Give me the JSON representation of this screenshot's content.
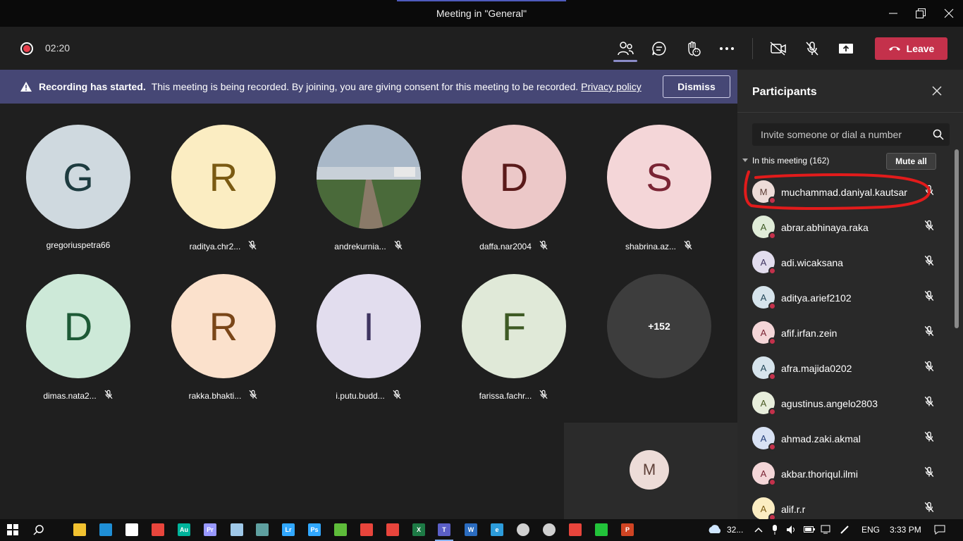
{
  "window": {
    "title": "Meeting in \"General\""
  },
  "meeting": {
    "timer": "02:20",
    "leave_label": "Leave"
  },
  "banner": {
    "bold": "Recording has started.",
    "text": "This meeting is being recorded. By joining, you are giving consent for this meeting to be recorded.",
    "link": "Privacy policy",
    "dismiss": "Dismiss"
  },
  "tiles": [
    {
      "initial": "G",
      "name": "gregoriuspetra66",
      "muted": false,
      "bg": "#cfd9df",
      "fg": "#1d3b3f"
    },
    {
      "initial": "R",
      "name": "raditya.chr2...",
      "muted": true,
      "bg": "#fbedc2",
      "fg": "#7a5a12"
    },
    {
      "initial": "",
      "name": "andrekurnia...",
      "muted": true,
      "bg": "#7a8a7a",
      "fg": "#ffffff"
    },
    {
      "initial": "D",
      "name": "daffa.nar2004",
      "muted": true,
      "bg": "#ecc8c8",
      "fg": "#5a1a1a"
    },
    {
      "initial": "S",
      "name": "shabrina.az...",
      "muted": true,
      "bg": "#f4d6d8",
      "fg": "#7a2434"
    },
    {
      "initial": "D",
      "name": "dimas.nata2...",
      "muted": true,
      "bg": "#cde9d8",
      "fg": "#1d5a36"
    },
    {
      "initial": "R",
      "name": "rakka.bhakti...",
      "muted": true,
      "bg": "#fbe1cc",
      "fg": "#7a4618"
    },
    {
      "initial": "I",
      "name": "i.putu.budd...",
      "muted": true,
      "bg": "#e2ddee",
      "fg": "#3e3460"
    },
    {
      "initial": "F",
      "name": "farissa.fachr...",
      "muted": true,
      "bg": "#e0e9d8",
      "fg": "#3e5a24"
    },
    {
      "initial": "+152",
      "name": "",
      "muted": false,
      "bg": "#3d3d3d",
      "fg": "#ffffff"
    }
  ],
  "selfview": {
    "initial": "M"
  },
  "participants": {
    "title": "Participants",
    "invite_placeholder": "Invite someone or dial a number",
    "section": "In this meeting (162)",
    "mute_all": "Mute all",
    "list": [
      {
        "initial": "M",
        "name": "muchammad.daniyal.kautsar",
        "bg": "#eddcd8",
        "fg": "#5e4038"
      },
      {
        "initial": "A",
        "name": "abrar.abhinaya.raka",
        "bg": "#e0ecd8",
        "fg": "#3e5a24"
      },
      {
        "initial": "A",
        "name": "adi.wicaksana",
        "bg": "#e2ddee",
        "fg": "#3e3460"
      },
      {
        "initial": "A",
        "name": "aditya.arief2102",
        "bg": "#d6e4ec",
        "fg": "#24485a"
      },
      {
        "initial": "A",
        "name": "afif.irfan.zein",
        "bg": "#f4d6d8",
        "fg": "#7a2434"
      },
      {
        "initial": "A",
        "name": "afra.majida0202",
        "bg": "#d6e4ec",
        "fg": "#24485a"
      },
      {
        "initial": "A",
        "name": "agustinus.angelo2803",
        "bg": "#e8eedc",
        "fg": "#4a5a24"
      },
      {
        "initial": "A",
        "name": "ahmad.zaki.akmal",
        "bg": "#d8e2f4",
        "fg": "#243e7a"
      },
      {
        "initial": "A",
        "name": "akbar.thoriqul.ilmi",
        "bg": "#f4d6d8",
        "fg": "#7a2434"
      },
      {
        "initial": "A",
        "name": "alif.r.r",
        "bg": "#fbedc2",
        "fg": "#7a5a12"
      }
    ]
  },
  "taskbar": {
    "apps": [
      {
        "name": "file-explorer",
        "color": "#f2c230",
        "label": ""
      },
      {
        "name": "edge",
        "color": "#1f8fd6",
        "label": ""
      },
      {
        "name": "store",
        "color": "#ffffff",
        "label": ""
      },
      {
        "name": "chrome",
        "color": "#e8453c",
        "label": ""
      },
      {
        "name": "audition",
        "color": "#00b39b",
        "label": "Au"
      },
      {
        "name": "premiere",
        "color": "#9999ff",
        "label": "Pr"
      },
      {
        "name": "notepad",
        "color": "#9fc8e8",
        "label": ""
      },
      {
        "name": "app-circle",
        "color": "#5fa0a0",
        "label": ""
      },
      {
        "name": "lightroom",
        "color": "#31a8ff",
        "label": "Lr"
      },
      {
        "name": "photoshop",
        "color": "#31a8ff",
        "label": "Ps"
      },
      {
        "name": "utorrent",
        "color": "#5ebc3a",
        "label": ""
      },
      {
        "name": "creative-cloud",
        "color": "#e8453c",
        "label": ""
      },
      {
        "name": "acrobat",
        "color": "#e8453c",
        "label": ""
      },
      {
        "name": "excel",
        "color": "#1d7a45",
        "label": "X"
      },
      {
        "name": "teams",
        "color": "#5b5fc7",
        "label": "T"
      },
      {
        "name": "word",
        "color": "#2b6cbf",
        "label": "W"
      },
      {
        "name": "internet-explorer",
        "color": "#2d9cdb",
        "label": "e"
      },
      {
        "name": "settings",
        "color": "#d0d0d0",
        "label": ""
      },
      {
        "name": "clock",
        "color": "#d0d0d0",
        "label": ""
      },
      {
        "name": "snipping",
        "color": "#e8453c",
        "label": ""
      },
      {
        "name": "line",
        "color": "#22c33a",
        "label": ""
      },
      {
        "name": "powerpoint",
        "color": "#d04423",
        "label": "P"
      }
    ],
    "temp": "32...",
    "lang": "ENG",
    "time": "3:33 PM"
  }
}
